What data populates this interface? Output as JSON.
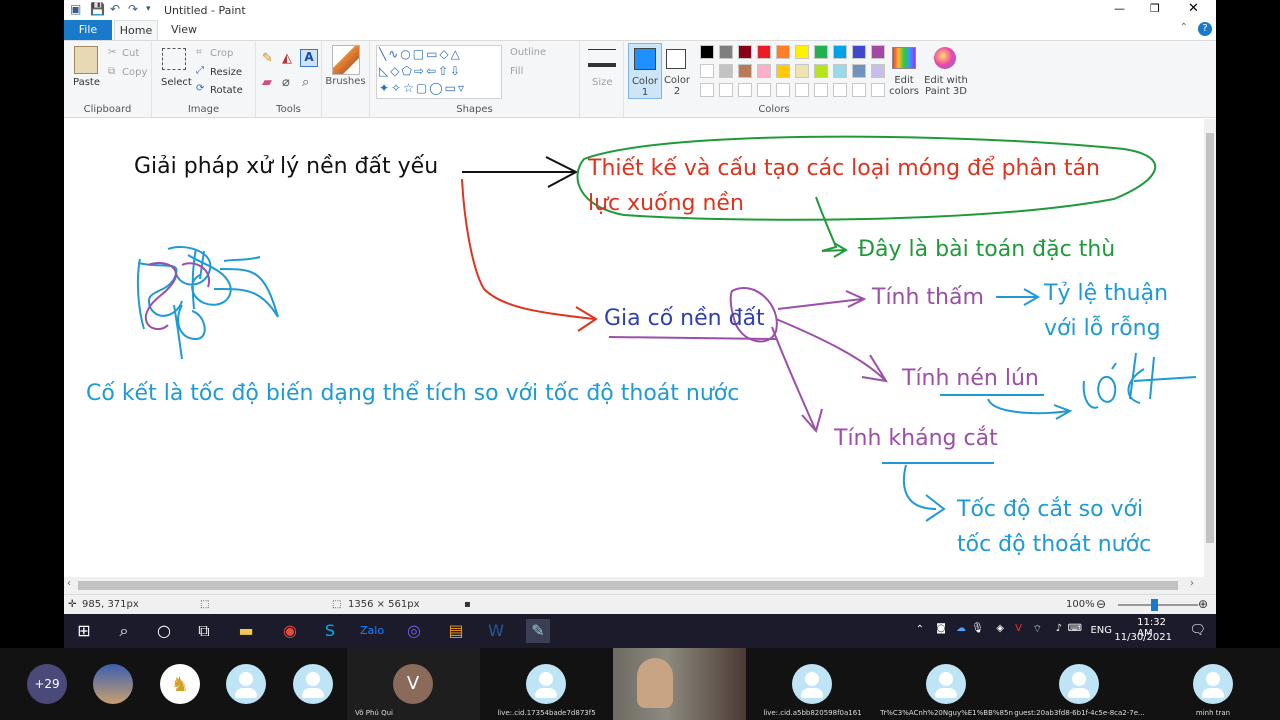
{
  "window": {
    "title": "Untitled - Paint",
    "min": "—",
    "max": "❐",
    "close": "✕"
  },
  "tabs": {
    "file": "File",
    "home": "Home",
    "view": "View"
  },
  "ribbon": {
    "clipboard": {
      "paste": "Paste",
      "cut": "Cut",
      "copy": "Copy",
      "label": "Clipboard"
    },
    "image": {
      "select": "Select",
      "crop": "Crop",
      "resize": "Resize",
      "rotate": "Rotate",
      "label": "Image"
    },
    "tools": {
      "label": "Tools"
    },
    "brushes": {
      "label": "Brushes"
    },
    "shapes": {
      "outline": "Outline",
      "fill": "Fill",
      "label": "Shapes"
    },
    "size": {
      "label": "Size"
    },
    "colors": {
      "color1": "Color 1",
      "color2": "Color 2",
      "edit": "Edit colors",
      "paint3d": "Edit with Paint 3D",
      "label": "Colors",
      "palette_row1": [
        "#000000",
        "#7f7f7f",
        "#880015",
        "#ed1c24",
        "#ff7f27",
        "#fff200",
        "#22b14c",
        "#00a2e8",
        "#3f48cc",
        "#a349a4"
      ],
      "palette_row2": [
        "#ffffff",
        "#c3c3c3",
        "#b97a57",
        "#ffaec9",
        "#ffc90e",
        "#efe4b0",
        "#b5e61d",
        "#99d9ea",
        "#7092be",
        "#c8bfe7"
      ],
      "color1_value": "#1e90ff"
    }
  },
  "canvas": {
    "t1": "Giải pháp xử lý nền đất yếu",
    "t2": "Thiết kế và cấu tạo các loại móng để phân tán",
    "t3": "lực xuống nền",
    "t4": "Đây là bài toán đặc thù",
    "t5": "Gia cố nền đất",
    "t6": "Tính thấm",
    "t7": "Tỷ lệ thuận",
    "t8": "với lỗ rỗng",
    "t9": "Tính nén lún",
    "t10": "Tính kháng cắt",
    "t11": "Cố kết là tốc độ biến dạng thể tích so với tốc độ thoát nước",
    "t12": "Tốc độ cắt so với",
    "t13": "tốc độ thoát nước",
    "colors": {
      "black": "#111111",
      "red": "#e0321e",
      "green": "#1f9a3a",
      "purple": "#9b4fa8",
      "blue": "#1e9ad6",
      "navy": "#2f3fb0"
    }
  },
  "status": {
    "cursor": "985, 371px",
    "size": "1356 × 561px",
    "zoom": "100%"
  },
  "taskbar": {
    "time": "11:32 AM",
    "date": "11/30/2021",
    "lang": "ENG"
  },
  "meeting": {
    "more": "+29",
    "tiles": [
      {
        "name": "Võ Phú Qui",
        "initial": "V"
      },
      {
        "name": "live:.cid.17354bade7d873f5"
      },
      {
        "name": "live:.cid.a5bb820598f0a161"
      },
      {
        "name": "Tr%C3%ACnh%20Nguy%E1%BB%85n"
      },
      {
        "name": "guest:20ab3fd8-6b1f-4c5e-8ca2-7e..."
      },
      {
        "name": "minh tran"
      }
    ]
  }
}
